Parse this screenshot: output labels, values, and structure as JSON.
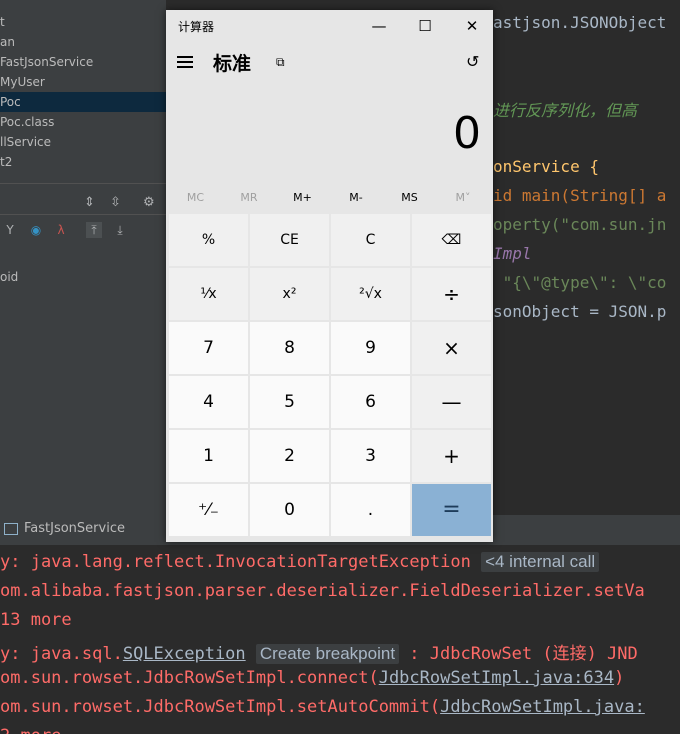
{
  "project_tree": {
    "items": [
      {
        "label": "t",
        "selected": false
      },
      {
        "label": "an",
        "selected": false
      },
      {
        "label": "FastJsonService",
        "selected": false
      },
      {
        "label": "MyUser",
        "selected": false
      },
      {
        "label": "Poc",
        "selected": true
      },
      {
        "label": "Poc.class",
        "selected": false
      },
      {
        "label": "llService",
        "selected": false
      },
      {
        "label": "t2",
        "selected": false
      }
    ],
    "debug_var": "oid"
  },
  "editor": {
    "lines": [
      {
        "text": "astjson.JSONObject"
      },
      {
        "text": "进行反序列化，但高"
      },
      {
        "text": "onService {"
      },
      {
        "text": "id main(String[] a"
      },
      {
        "text": "operty(\"com.sun.jn"
      },
      {
        "text": "Impl"
      },
      {
        "text": " \"{\\\"@type\\\": \\\"co"
      },
      {
        "text": "sonObject = JSON.p"
      }
    ]
  },
  "bottom_tab": {
    "label": "FastJsonService"
  },
  "console": {
    "line1_prefix": "y: java.lang.reflect.InvocationTargetException",
    "line1_chip": "<4 internal call",
    "line2": "om.alibaba.fastjson.parser.deserializer.FieldDeserializer.setVa",
    "line3": "13 more",
    "line4_prefix": "y: java.sql.",
    "line4_link": "SQLException",
    "line4_chip": "Create breakpoint",
    "line4_suffix": " : JdbcRowSet (连接) JND",
    "line5_prefix": "om.sun.rowset.JdbcRowSetImpl.connect(",
    "line5_link": "JdbcRowSetImpl.java:634",
    "line5_suffix": ")",
    "line6_prefix": "om.sun.rowset.JdbcRowSetImpl.setAutoCommit(",
    "line6_link": "JdbcRowSetImpl.java:",
    "line7": "2 more"
  },
  "calculator": {
    "title": "计算器",
    "mode": "标准",
    "display": "0",
    "window_buttons": {
      "minimize": "—",
      "maximize": "☐",
      "close": "✕"
    },
    "memory": [
      {
        "label": "MC",
        "enabled": false
      },
      {
        "label": "MR",
        "enabled": false
      },
      {
        "label": "M+",
        "enabled": true
      },
      {
        "label": "M-",
        "enabled": true
      },
      {
        "label": "MS",
        "enabled": true
      },
      {
        "label": "M˅",
        "enabled": false
      }
    ],
    "keys": [
      {
        "label": "%",
        "kind": "fn",
        "name": "percent"
      },
      {
        "label": "CE",
        "kind": "fn",
        "name": "clear-entry"
      },
      {
        "label": "C",
        "kind": "fn",
        "name": "clear"
      },
      {
        "label": "⌫",
        "kind": "fn",
        "name": "backspace"
      },
      {
        "label": "¹⁄x",
        "kind": "fn",
        "name": "reciprocal"
      },
      {
        "label": "x²",
        "kind": "fn",
        "name": "square"
      },
      {
        "label": "²√x",
        "kind": "fn",
        "name": "square-root"
      },
      {
        "label": "÷",
        "kind": "op",
        "name": "divide"
      },
      {
        "label": "7",
        "kind": "digit",
        "name": "digit-7"
      },
      {
        "label": "8",
        "kind": "digit",
        "name": "digit-8"
      },
      {
        "label": "9",
        "kind": "digit",
        "name": "digit-9"
      },
      {
        "label": "×",
        "kind": "op",
        "name": "multiply"
      },
      {
        "label": "4",
        "kind": "digit",
        "name": "digit-4"
      },
      {
        "label": "5",
        "kind": "digit",
        "name": "digit-5"
      },
      {
        "label": "6",
        "kind": "digit",
        "name": "digit-6"
      },
      {
        "label": "—",
        "kind": "op",
        "name": "subtract"
      },
      {
        "label": "1",
        "kind": "digit",
        "name": "digit-1"
      },
      {
        "label": "2",
        "kind": "digit",
        "name": "digit-2"
      },
      {
        "label": "3",
        "kind": "digit",
        "name": "digit-3"
      },
      {
        "label": "+",
        "kind": "op",
        "name": "add"
      },
      {
        "label": "⁺⁄₋",
        "kind": "digit",
        "name": "negate"
      },
      {
        "label": "0",
        "kind": "digit",
        "name": "digit-0"
      },
      {
        "label": ".",
        "kind": "digit",
        "name": "decimal"
      },
      {
        "label": "=",
        "kind": "eq",
        "name": "equals"
      }
    ]
  }
}
